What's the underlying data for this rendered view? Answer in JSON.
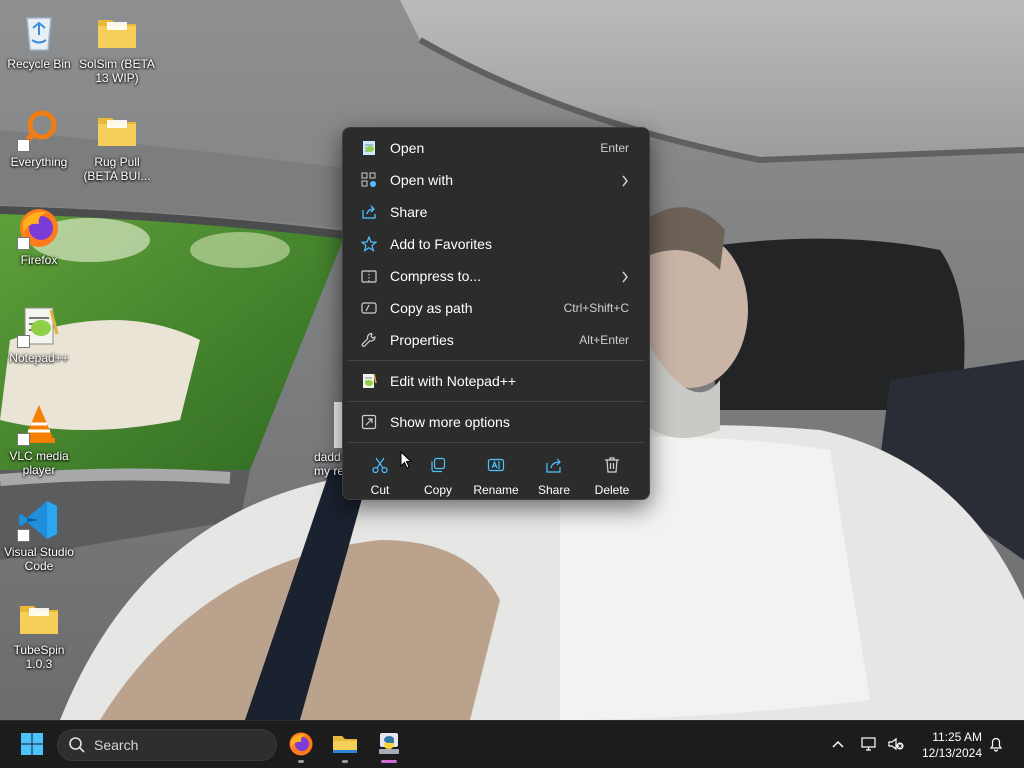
{
  "desktop": {
    "icons": [
      {
        "label": "Recycle Bin",
        "icon": "recycle-bin-icon"
      },
      {
        "label": "SolSim (BETA 13 WIP)",
        "icon": "folder-icon"
      },
      {
        "label": "Everything",
        "icon": "everything-icon"
      },
      {
        "label": "Rug Pull (BETA BUI...",
        "icon": "folder-icon"
      },
      {
        "label": "Firefox",
        "icon": "firefox-icon"
      },
      {
        "label": "Notepad++",
        "icon": "notepadpp-icon"
      },
      {
        "label": "VLC media player",
        "icon": "vlc-icon"
      },
      {
        "label": "Visual Studio Code",
        "icon": "vscode-icon"
      },
      {
        "label": "TubeSpin 1.0.3",
        "icon": "folder-icon"
      },
      {
        "label": "dadd my re",
        "icon": "file-icon"
      }
    ]
  },
  "context_menu": {
    "items": [
      {
        "label": "Open",
        "shortcut": "Enter",
        "icon": "notepad-file-icon"
      },
      {
        "label": "Open with",
        "shortcut": "",
        "icon": "open-with-icon",
        "submenu": true
      },
      {
        "label": "Share",
        "shortcut": "",
        "icon": "share-icon"
      },
      {
        "label": "Add to Favorites",
        "shortcut": "",
        "icon": "star-icon"
      },
      {
        "label": "Compress to...",
        "shortcut": "",
        "icon": "zip-icon",
        "submenu": true
      },
      {
        "label": "Copy as path",
        "shortcut": "Ctrl+Shift+C",
        "icon": "copy-path-icon"
      },
      {
        "label": "Properties",
        "shortcut": "Alt+Enter",
        "icon": "wrench-icon"
      }
    ],
    "extra_items": [
      {
        "label": "Edit with Notepad++",
        "icon": "notepadpp-icon"
      },
      {
        "label": "Show more options",
        "icon": "show-more-icon"
      }
    ],
    "actions": [
      {
        "label": "Cut",
        "icon": "scissors-icon"
      },
      {
        "label": "Copy",
        "icon": "copy-icon"
      },
      {
        "label": "Rename",
        "icon": "rename-icon"
      },
      {
        "label": "Share",
        "icon": "share-icon"
      },
      {
        "label": "Delete",
        "icon": "trash-icon"
      }
    ],
    "accent_color": "#4cc2ff"
  },
  "taskbar": {
    "search_placeholder": "Search",
    "pinned": [
      "start-icon",
      "firefox-icon",
      "file-explorer-icon",
      "python-idle-icon"
    ],
    "clock_time": "11:25 AM",
    "clock_date": "12/13/2024"
  }
}
